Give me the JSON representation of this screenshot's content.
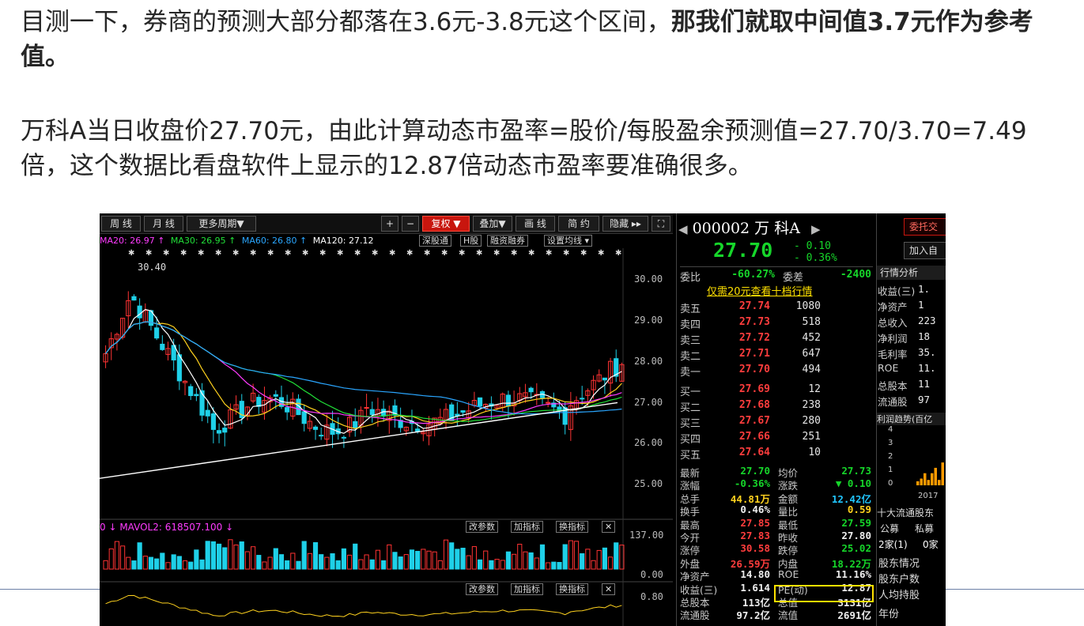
{
  "slide": {
    "p1_normal": "目测一下，券商的预测大部分都落在3.6元-3.8元这个区间，",
    "p1_bold": "那我们就取中间值3.7元作为参考值。",
    "p2": "万科A当日收盘价27.70元，由此计算动态市盈率=股价/每股盈余预测值=27.70/3.70=7.49倍，这个数据比看盘软件上显示的12.87倍动态市盈率要准确很多。"
  },
  "toolbar": {
    "weekly": "周 线",
    "monthly": "月 线",
    "more_periods": "更多周期▼",
    "plus": "+",
    "minus": "−",
    "restore_rights": "复权 ▼",
    "overlay": "叠加▼",
    "draw_lines": "画 线",
    "simple": "简 约",
    "hide": "隐藏 ▸▸",
    "fullscreen": "⛶"
  },
  "ma_bar": {
    "ma20": "MA20: 26.97 ↑",
    "ma30": "MA30: 26.95 ↑",
    "ma60": "MA60: 26.80 ↑",
    "ma120": "MA120: 27.12",
    "chip_shenzhen": "深股通",
    "chip_h": "H股",
    "chip_margin": "融资融券",
    "chip_settings": "设置均线 ▾"
  },
  "chart": {
    "y_ticks": [
      "30.00",
      "29.00",
      "28.00",
      "27.00",
      "26.00",
      "25.00"
    ],
    "high_annotation": "30.40",
    "vol_header": "0 ↓  MAVOL2: 618507.100 ↓",
    "vol_ticks": [
      "137.00",
      "0.00"
    ],
    "macd_tick": "0.80",
    "btn_change_params": "改参数",
    "btn_add_indicator": "加指标",
    "btn_switch_indicator": "换指标",
    "btn_close": "✕",
    "colors": {
      "up": "#ff3333",
      "down": "#1fd0e8",
      "ma5": "#ffffff",
      "ma10": "#ffd21e",
      "ma20": "#ff3cff",
      "ma30": "#21e038",
      "ma60": "#2aa6ff",
      "ma120": "#ffffff"
    }
  },
  "quote": {
    "code_name": "000002 万  科A",
    "price": "27.70",
    "change": "- 0.10",
    "change_pct": "- 0.36%",
    "weibi_label": "委比",
    "weibi": "-60.27%",
    "weicha_label": "委差",
    "weicha": "-2400",
    "ten_levels": "仅需20元查看十档行情",
    "asks": [
      {
        "label": "卖五",
        "price": "27.74",
        "vol": "1080"
      },
      {
        "label": "卖四",
        "price": "27.73",
        "vol": "518"
      },
      {
        "label": "卖三",
        "price": "27.72",
        "vol": "452"
      },
      {
        "label": "卖二",
        "price": "27.71",
        "vol": "647"
      },
      {
        "label": "卖一",
        "price": "27.70",
        "vol": "494"
      }
    ],
    "bids": [
      {
        "label": "买一",
        "price": "27.69",
        "vol": "12"
      },
      {
        "label": "买二",
        "price": "27.68",
        "vol": "238"
      },
      {
        "label": "买三",
        "price": "27.67",
        "vol": "280"
      },
      {
        "label": "买四",
        "price": "27.66",
        "vol": "251"
      },
      {
        "label": "买五",
        "price": "27.64",
        "vol": "10"
      }
    ],
    "stats": [
      {
        "k1": "最新",
        "v1": "27.70",
        "c1": "green",
        "k2": "均价",
        "v2": "27.73",
        "c2": "green"
      },
      {
        "k1": "涨幅",
        "v1": "-0.36%",
        "c1": "green",
        "k2": "涨跌",
        "v2": "▼ 0.10",
        "c2": "green"
      },
      {
        "k1": "总手",
        "v1": "44.81万",
        "c1": "yellow",
        "k2": "金额",
        "v2": "12.42亿",
        "c2": "cyan"
      },
      {
        "k1": "换手",
        "v1": "0.46%",
        "c1": "white",
        "k2": "量比",
        "v2": "0.59",
        "c2": "yellow"
      },
      {
        "k1": "最高",
        "v1": "27.85",
        "c1": "red",
        "k2": "最低",
        "v2": "27.59",
        "c2": "green"
      },
      {
        "k1": "今开",
        "v1": "27.83",
        "c1": "red",
        "k2": "昨收",
        "v2": "27.80",
        "c2": "white"
      },
      {
        "k1": "涨停",
        "v1": "30.58",
        "c1": "red",
        "k2": "跌停",
        "v2": "25.02",
        "c2": "green"
      },
      {
        "k1": "外盘",
        "v1": "26.59万",
        "c1": "red",
        "k2": "内盘",
        "v2": "18.22万",
        "c2": "green"
      },
      {
        "k1": "净资产",
        "v1": "14.80",
        "c1": "white",
        "k2": "ROE",
        "v2": "11.16%",
        "c2": "white"
      },
      {
        "k1": "收益(三)",
        "v1": "1.614",
        "c1": "white",
        "k2": "PE(动)",
        "v2": "12.87",
        "c2": "white"
      },
      {
        "k1": "总股本",
        "v1": "113亿",
        "c1": "white",
        "k2": "总值",
        "v2": "3131亿",
        "c2": "white"
      },
      {
        "k1": "流通股",
        "v1": "97.2亿",
        "c1": "white",
        "k2": "流值",
        "v2": "2691亿",
        "c2": "white"
      }
    ]
  },
  "fundamentals": {
    "btn_entrust": "委托交",
    "btn_add_self": "加入自",
    "tab": "行情分析",
    "rows": [
      {
        "k": "收益(三)",
        "v": "1."
      },
      {
        "k": "净资产",
        "v": "1"
      },
      {
        "k": "总收入",
        "v": "223"
      },
      {
        "k": "净利润",
        "v": "18"
      },
      {
        "k": "毛利率",
        "v": "35."
      },
      {
        "k": "ROE",
        "v": "11."
      },
      {
        "k": "总股本",
        "v": "11"
      },
      {
        "k": "流通股",
        "v": "97"
      }
    ],
    "trend_title": "利润趋势(百亿",
    "trend_ticks": [
      "4",
      "3",
      "2",
      "1",
      "0"
    ],
    "trend_year": "2017",
    "trend_values": [
      0.3,
      0.5,
      0.9,
      0.4,
      0.9,
      1.3,
      0.4,
      1.7
    ],
    "top10": "十大流通股东",
    "fund_label": "公募",
    "private_label": "私募",
    "fund_count": "2家(1)",
    "private_count": "0家",
    "holder_info": "股东情况",
    "holder_count": "股东户数",
    "avg_hold": "人均持股",
    "year_label": "年份"
  }
}
